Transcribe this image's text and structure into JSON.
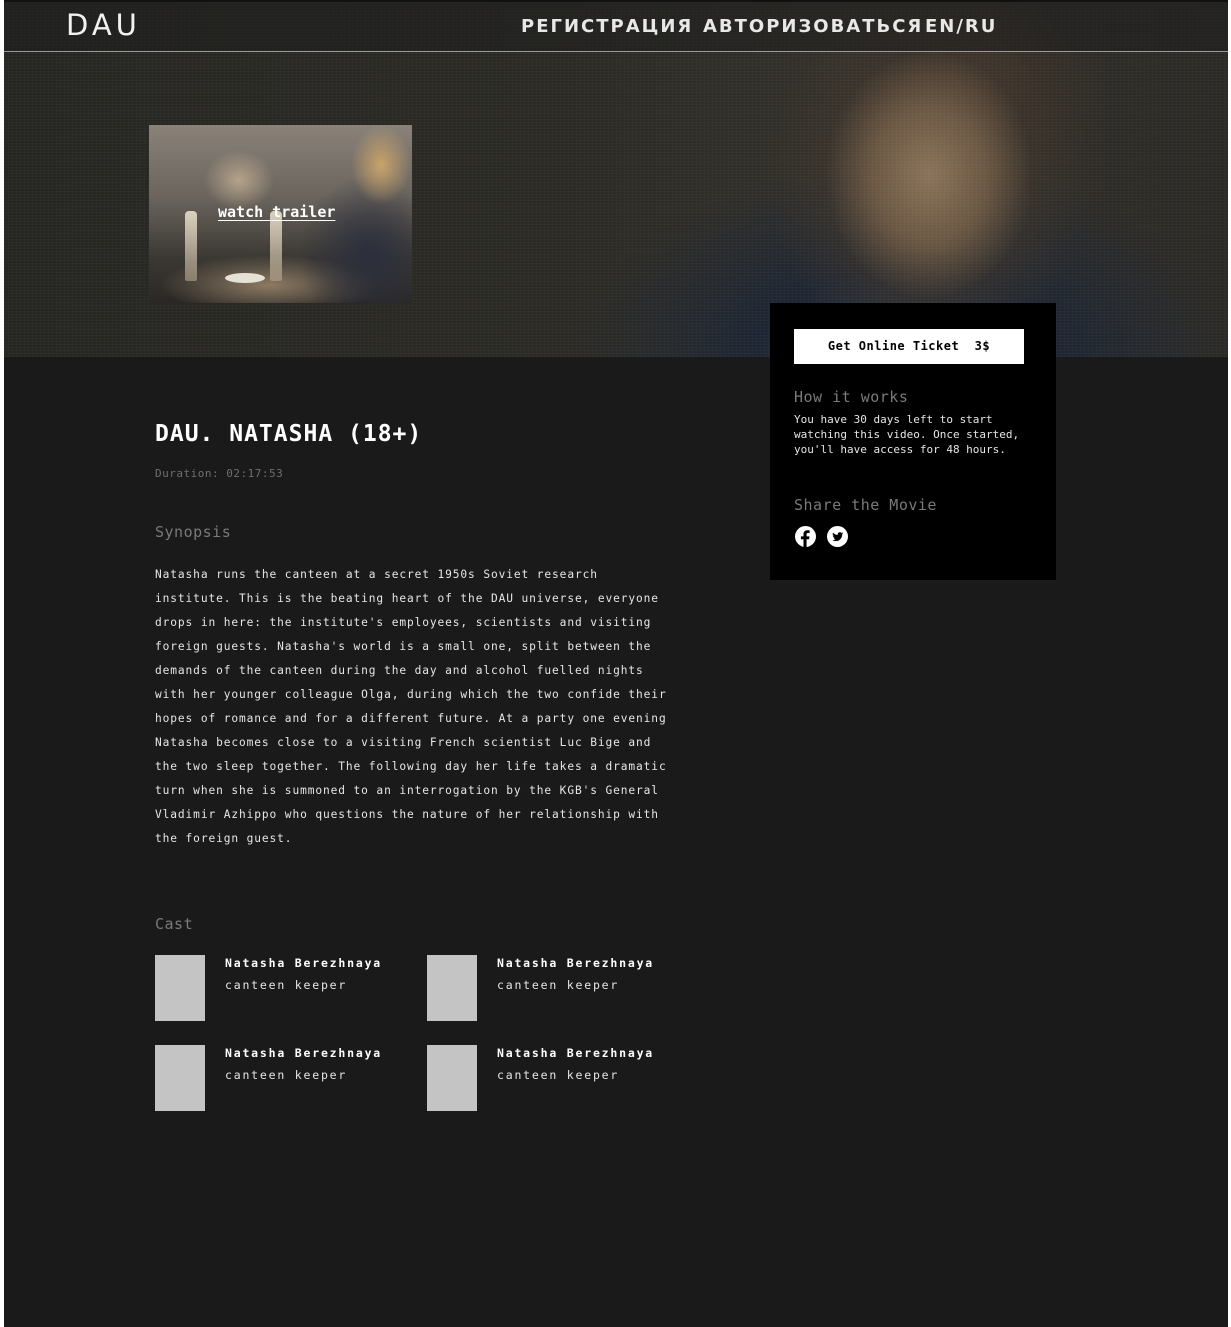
{
  "header": {
    "logo": "DAU",
    "nav": {
      "register": "РЕГИСТРАЦИЯ",
      "login": "АВТОРИЗОВАТЬСЯ",
      "language": "EN/RU"
    }
  },
  "hero": {
    "trailer_label": "watch trailer"
  },
  "ticket_panel": {
    "button_label": "Get Online Ticket  3$",
    "how_title": "How it works",
    "how_text": "You have 30 days left to start watching this video. Once started, you'll have access for 48 hours.",
    "share_title": "Share the Movie",
    "share_icons": [
      "facebook-icon",
      "twitter-icon"
    ]
  },
  "movie": {
    "title": "DAU. NATASHA (18+)",
    "duration": "Duration: 02:17:53",
    "synopsis_title": "Synopsis",
    "synopsis": "Natasha runs the canteen at a secret 1950s Soviet research institute. This is the beating heart of the DAU universe, everyone drops in here: the institute's employees, scientists and visiting foreign guests. Natasha's world is a small one, split between the demands of the canteen during the day and alcohol fuelled nights with her younger colleague Olga, during which the two confide their hopes of romance and for a different future. At a party one evening Natasha becomes close to a visiting French scientist Luc Bige and the two sleep together. The following day her life takes a dramatic turn when she is summoned to an interrogation by the KGB's General Vladimir Azhippo who questions the nature of her relationship with the foreign guest.",
    "cast_title": "Cast",
    "cast": [
      {
        "name": "Natasha Berezhnaya",
        "role": "canteen keeper"
      },
      {
        "name": "Natasha Berezhnaya",
        "role": "canteen keeper"
      },
      {
        "name": "Natasha Berezhnaya",
        "role": "canteen keeper"
      },
      {
        "name": "Natasha Berezhnaya",
        "role": "canteen keeper"
      }
    ]
  },
  "colors": {
    "page_background": "#1a1a1a",
    "panel_background": "#000000",
    "button_background": "#ffffff",
    "muted_text": "#7a7a7a",
    "cast_placeholder": "#c4c4c4"
  }
}
